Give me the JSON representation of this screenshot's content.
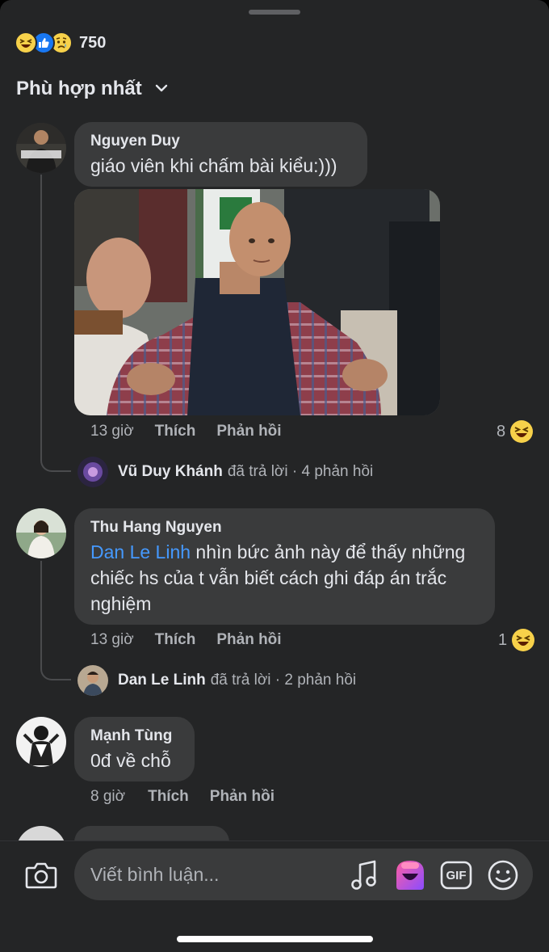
{
  "reactions": {
    "count": "750",
    "icons": [
      "haha-icon",
      "like-icon",
      "sad-icon"
    ]
  },
  "sort": {
    "label": "Phù hợp nhất"
  },
  "comments": [
    {
      "author": "Nguyen Duy",
      "text": "giáo viên khi chấm bài kiểu:)))",
      "time": "13 giờ",
      "like": "Thích",
      "reply": "Phản hồi",
      "reaction_count": "8",
      "reply_summary": {
        "name": "Vũ Duy Khánh",
        "text": "đã trả lời · 4 phản hồi"
      }
    },
    {
      "author": "Thu Hang Nguyen",
      "mention": "Dan Le Linh",
      "text_line1": " nhìn bức ảnh này để thấy những",
      "text_line2": "chiếc hs của t vẫn biết cách ghi đáp án trắc",
      "text_line3": "nghiệm",
      "time": "13 giờ",
      "like": "Thích",
      "reply": "Phản hồi",
      "reaction_count": "1",
      "reply_summary": {
        "name": "Dan Le Linh",
        "text": "đã trả lời · 2 phản hồi"
      }
    },
    {
      "author": "Mạnh Tùng",
      "text": "0đ về chỗ",
      "time": "8 giờ",
      "like": "Thích",
      "reply": "Phản hồi"
    }
  ],
  "composer": {
    "placeholder": "Viết bình luận...",
    "gif_label": "GIF"
  },
  "colors": {
    "background": "#242526",
    "bubble": "#3a3b3c",
    "mention": "#4599ff",
    "muted": "#b0b3b8"
  }
}
